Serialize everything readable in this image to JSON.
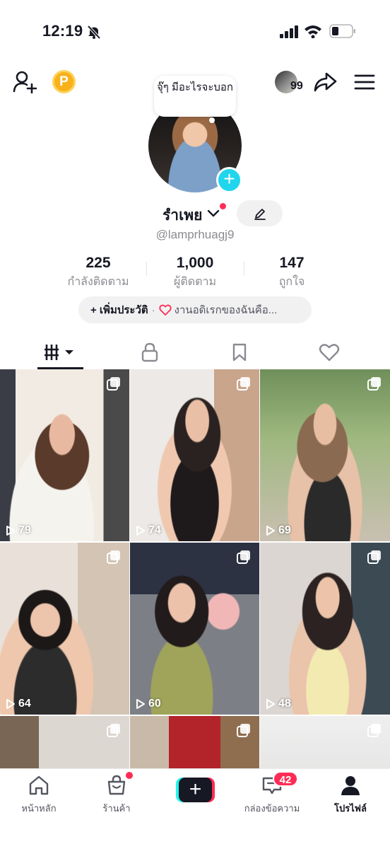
{
  "status_bar": {
    "time": "12:19"
  },
  "profile": {
    "note_bubble": "จุ๊ๆ มีอะไรจะบอก",
    "display_name": "รำเพย",
    "username": "@lamprhuagj9",
    "friends_count": "99",
    "stats": [
      {
        "value": "225",
        "label": "กำลังติดตาม"
      },
      {
        "value": "1,000",
        "label": "ผู้ติดตาม"
      },
      {
        "value": "147",
        "label": "ถูกใจ"
      }
    ],
    "bio": {
      "add_label": "+ เพิ่มประวัติ",
      "separator": "·",
      "text": "งานอดิเรกของฉันคือ..."
    }
  },
  "tabs": [
    {
      "name": "videos",
      "icon": "grid-icon",
      "active": true
    },
    {
      "name": "private",
      "icon": "lock-icon",
      "active": false
    },
    {
      "name": "favorites",
      "icon": "bookmark-icon",
      "active": false
    },
    {
      "name": "liked",
      "icon": "heart-icon",
      "active": false
    }
  ],
  "videos": [
    {
      "views": "79"
    },
    {
      "views": "74"
    },
    {
      "views": "69"
    },
    {
      "views": "64"
    },
    {
      "views": "60"
    },
    {
      "views": "48"
    },
    {
      "views": ""
    },
    {
      "views": ""
    },
    {
      "views": ""
    }
  ],
  "bottom_nav": {
    "home": "หน้าหลัก",
    "shop": "ร้านค้า",
    "inbox": "กล่องข้อความ",
    "inbox_badge": "42",
    "profile": "โปรไฟล์"
  },
  "colors": {
    "accent": "#fe2c55",
    "cyan": "#25f4ee",
    "plus_badge": "#20d5ec",
    "coin": "#f8b11a"
  }
}
